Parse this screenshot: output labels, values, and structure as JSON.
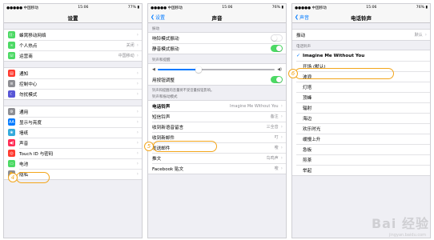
{
  "accent_color": "#007aff",
  "callout_color": "#f3a61c",
  "status": {
    "carrier": "●●●●● 中国移动 ",
    "time": "15:06",
    "battery_p1": "77% ",
    "battery_p2": "76% ",
    "battery_p3": "76% "
  },
  "settings": {
    "title": "设置",
    "group1": [
      {
        "label": "蜂窝移动网络",
        "icon": "cellular-icon",
        "color": "#4cd964",
        "value": ""
      },
      {
        "label": "个人热点",
        "icon": "hotspot-icon",
        "color": "#4cd964",
        "value": "关闭"
      },
      {
        "label": "运营商",
        "icon": "carrier-icon",
        "color": "#4cd964",
        "value": "中国移动"
      }
    ],
    "group2": [
      {
        "label": "通知",
        "icon": "notifications-icon",
        "color": "#ff3b30"
      },
      {
        "label": "控制中心",
        "icon": "control-center-icon",
        "color": "#8e8e93"
      },
      {
        "label": "勿扰模式",
        "icon": "do-not-disturb-icon",
        "color": "#5856d6"
      }
    ],
    "group3": [
      {
        "label": "通用",
        "icon": "gear-icon",
        "color": "#8e8e93"
      },
      {
        "label": "显示与亮度",
        "icon": "display-icon",
        "color": "#007aff"
      },
      {
        "label": "墙纸",
        "icon": "wallpaper-icon",
        "color": "#34aadc"
      },
      {
        "label": "声音",
        "icon": "sound-icon",
        "color": "#ff2d55"
      },
      {
        "label": "Touch ID 与密码",
        "icon": "fingerprint-icon",
        "color": "#ff3b30"
      },
      {
        "label": "电池",
        "icon": "battery-icon",
        "color": "#4cd964"
      },
      {
        "label": "隐私",
        "icon": "hand-icon",
        "color": "#8e8e93"
      }
    ],
    "callout_number": "4"
  },
  "sounds": {
    "back": "设置",
    "title": "声音",
    "vibrate_header": "振动",
    "vibrate_on_ring": "响铃模式振动",
    "vibrate_on_silent": "静音模式振动",
    "ringer_header": "铃声和提醒",
    "volume_fraction": 0.35,
    "change_with_buttons": "用按钮调整",
    "change_with_buttons_footer": "铃声和提醒的音量将不受音量按钮影响。",
    "patterns_header": "铃声和振动模式",
    "patterns": [
      {
        "label": "电话铃声",
        "value": "Imagine Me Without You"
      },
      {
        "label": "短信铃声",
        "value": "备注"
      },
      {
        "label": "收到新语音留言",
        "value": "三全音"
      },
      {
        "label": "收到新邮件",
        "value": "叮"
      },
      {
        "label": "发送邮件",
        "value": "嗖"
      },
      {
        "label": "推文",
        "value": "鸟鸣声"
      },
      {
        "label": "Facebook 贴文",
        "value": "嗖"
      }
    ],
    "callout_number": "5"
  },
  "ringtone": {
    "back": "声音",
    "title": "电话铃声",
    "vibration_label": "振动",
    "vibration_value": "默认",
    "ringtones_header": "电话铃声",
    "selected": "Imagine Me Without You",
    "list": [
      "开场 (默认)",
      "波浪",
      "灯塔",
      "顶峰",
      "辐射",
      "海边",
      "欢乐时光",
      "缓慢上升",
      "急板",
      "煎茶",
      "举起"
    ],
    "callout_number": "6"
  },
  "watermark": {
    "text": "Bai 经验",
    "url": "jingyan.baidu.com"
  }
}
